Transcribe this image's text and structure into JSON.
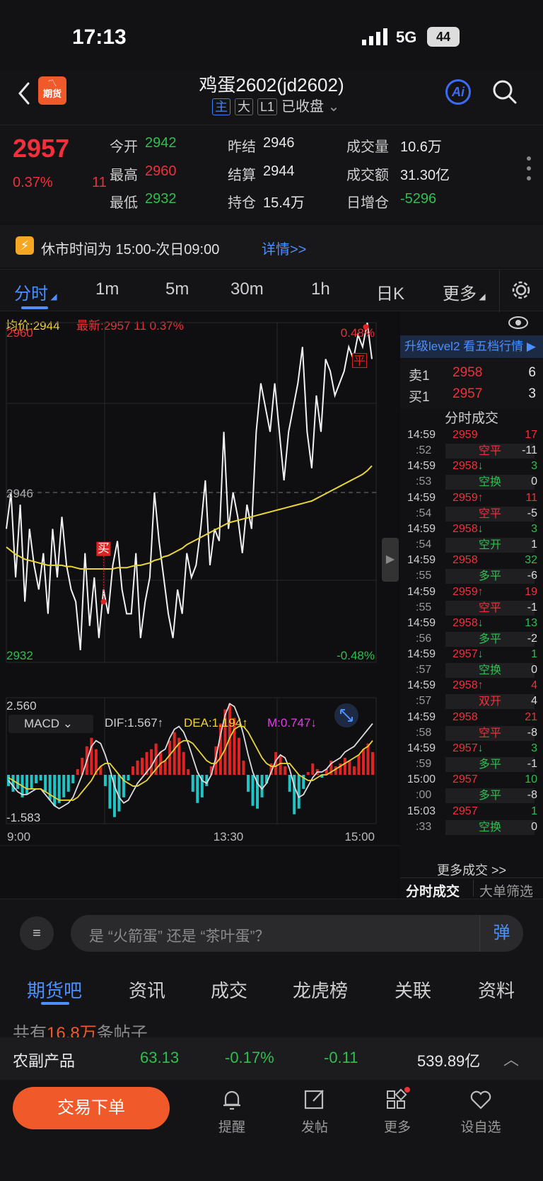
{
  "status": {
    "time": "17:13",
    "network": "5G",
    "battery": "44"
  },
  "header": {
    "logo_text": "期货",
    "title": "鸡蛋2602(jd2602)",
    "badges": [
      "主",
      "大",
      "L1"
    ],
    "status": "已收盘",
    "ai": "Ai"
  },
  "quote": {
    "price": "2957",
    "change_pct": "0.37%",
    "change": "11",
    "fields": [
      {
        "label": "今开",
        "value": "2942",
        "color": "green"
      },
      {
        "label": "昨结",
        "value": "2946",
        "color": "white"
      },
      {
        "label": "成交量",
        "value": "10.6万",
        "color": "white"
      },
      {
        "label": "最高",
        "value": "2960",
        "color": "red"
      },
      {
        "label": "结算",
        "value": "2944",
        "color": "white"
      },
      {
        "label": "成交额",
        "value": "31.30亿",
        "color": "white"
      },
      {
        "label": "最低",
        "value": "2932",
        "color": "green"
      },
      {
        "label": "持仓",
        "value": "15.4万",
        "color": "white"
      },
      {
        "label": "日增仓",
        "value": "-5296",
        "color": "green"
      }
    ]
  },
  "notice": {
    "text": "休市时间为 15:00-次日09:00",
    "link": "详情>>"
  },
  "tabs": [
    "分时",
    "1m",
    "5m",
    "30m",
    "1h",
    "日K",
    "更多"
  ],
  "chart_info": {
    "avg_label": "均价:2944",
    "latest_label": "最新:2957 11 0.37%"
  },
  "chart_data": {
    "type": "line",
    "ylim": [
      2932,
      2960
    ],
    "x_ticks": [
      "9:00",
      "13:30",
      "15:00"
    ],
    "y_labels": {
      "top": "2960",
      "mid": "2946",
      "bottom": "2932",
      "top_pct": "0.48%",
      "bottom_pct": "-0.48%"
    },
    "series": [
      {
        "name": "价格",
        "values": [
          2943,
          2946,
          2939,
          2945,
          2937,
          2943,
          2940,
          2938,
          2941,
          2936,
          2943,
          2939,
          2944,
          2940,
          2938,
          2937,
          2933,
          2941,
          2935,
          2939,
          2934,
          2938,
          2936,
          2940,
          2942,
          2938,
          2936,
          2936,
          2941,
          2934,
          2937,
          2939,
          2946,
          2942,
          2939,
          2936,
          2934,
          2938,
          2936,
          2941,
          2939,
          2940,
          2943,
          2947,
          2940,
          2943,
          2942,
          2951,
          2943,
          2946,
          2944,
          2941,
          2945,
          2943,
          2951,
          2955,
          2953,
          2951,
          2955,
          2951,
          2947,
          2951,
          2953,
          2955,
          2958,
          2951,
          2948,
          2954,
          2951,
          2957,
          2956,
          2954,
          2955,
          2956,
          2958,
          2957,
          2959,
          2958,
          2960,
          2957
        ]
      },
      {
        "name": "均价",
        "values": [
          2941.5,
          2941.2,
          2940.9,
          2940.7,
          2940.5,
          2940.4,
          2940.3,
          2940.2,
          2940.1,
          2940.0,
          2940.0,
          2940.0,
          2940.0,
          2939.9,
          2939.9,
          2939.8,
          2939.7,
          2939.7,
          2939.7,
          2939.7,
          2939.7,
          2939.7,
          2939.7,
          2939.7,
          2939.8,
          2939.8,
          2939.8,
          2939.9,
          2940.0,
          2940.0,
          2940.1,
          2940.2,
          2940.4,
          2940.5,
          2940.7,
          2940.8,
          2941.0,
          2941.2,
          2941.4,
          2941.7,
          2941.9,
          2942.1,
          2942.3,
          2942.5,
          2942.7,
          2942.9,
          2943.1,
          2943.3,
          2943.5,
          2943.6,
          2943.7,
          2943.8,
          2943.9,
          2944.0,
          2944.1,
          2944.2,
          2944.3,
          2944.4,
          2944.5,
          2944.6,
          2944.7,
          2944.8,
          2944.9,
          2945.0,
          2945.1,
          2945.2,
          2945.3,
          2945.5,
          2945.7,
          2945.9,
          2946.1,
          2946.3,
          2946.5,
          2946.7,
          2946.9,
          2947.1,
          2947.3,
          2947.5,
          2947.8,
          2948.2
        ]
      }
    ],
    "markers": [
      {
        "text": "买"
      },
      {
        "text": "平"
      }
    ],
    "macd": {
      "label": "MACD",
      "dif": "DIF:1.567↑",
      "dea": "DEA:1.194↑",
      "m": "M:0.747↓",
      "ymax": "2.560",
      "ymin": "-1.583",
      "hist": [
        -0.4,
        -0.6,
        -0.5,
        -0.8,
        -0.7,
        -0.5,
        -0.3,
        -0.2,
        -0.6,
        -0.9,
        -1.1,
        -1.0,
        -0.8,
        -0.6,
        -0.3,
        0.2,
        0.6,
        1.0,
        1.3,
        0.9,
        0.3,
        -0.4,
        -1.2,
        -1.5,
        -1.3,
        -0.8,
        -0.2,
        0.3,
        0.5,
        0.6,
        0.8,
        0.9,
        1.1,
        0.8,
        0.5,
        1.2,
        1.5,
        1.3,
        0.8,
        0.2,
        -0.6,
        -1.0,
        -0.8,
        -0.4,
        0.3,
        1.0,
        1.8,
        2.3,
        2.5,
        2.0,
        1.3,
        0.5,
        -0.6,
        -1.1,
        -1.2,
        -0.8,
        -0.3,
        0.4,
        0.8,
        0.7,
        0.3,
        -0.6,
        -1.4,
        -1.2,
        -0.5,
        0.1,
        0.4,
        0.2,
        -0.1,
        0.2,
        0.5,
        0.3,
        0.4,
        0.6,
        0.5,
        0.3,
        0.7,
        0.9,
        1.1,
        0.8
      ],
      "dif_values": [
        -0.2,
        -0.4,
        -0.6,
        -0.7,
        -0.7,
        -0.6,
        -0.5,
        -0.5,
        -0.7,
        -0.9,
        -1.1,
        -1.2,
        -1.1,
        -1.0,
        -0.8,
        -0.4,
        0.0,
        0.5,
        1.0,
        1.2,
        1.1,
        0.7,
        0.2,
        -0.4,
        -0.8,
        -1.0,
        -0.9,
        -0.6,
        -0.3,
        -0.1,
        0.1,
        0.3,
        0.6,
        0.8,
        0.9,
        1.3,
        1.6,
        1.7,
        1.5,
        1.1,
        0.6,
        0.1,
        -0.2,
        -0.3,
        0.0,
        0.6,
        1.4,
        2.1,
        2.5,
        2.4,
        2.0,
        1.4,
        0.7,
        0.1,
        -0.3,
        -0.5,
        -0.3,
        0.1,
        0.5,
        0.7,
        0.6,
        0.2,
        -0.4,
        -0.8,
        -0.7,
        -0.4,
        -0.1,
        0.1,
        0.1,
        0.2,
        0.4,
        0.5,
        0.6,
        0.8,
        0.9,
        1.0,
        1.2,
        1.4,
        1.6,
        1.8
      ],
      "dea_values": [
        -0.1,
        -0.2,
        -0.3,
        -0.4,
        -0.5,
        -0.5,
        -0.5,
        -0.5,
        -0.6,
        -0.7,
        -0.8,
        -0.9,
        -0.9,
        -0.9,
        -0.9,
        -0.8,
        -0.6,
        -0.4,
        -0.2,
        0.1,
        0.3,
        0.4,
        0.4,
        0.2,
        0.0,
        -0.2,
        -0.3,
        -0.4,
        -0.4,
        -0.3,
        -0.2,
        0.0,
        0.2,
        0.4,
        0.5,
        0.7,
        0.9,
        1.1,
        1.2,
        1.2,
        1.1,
        0.9,
        0.7,
        0.5,
        0.4,
        0.4,
        0.6,
        0.9,
        1.3,
        1.6,
        1.7,
        1.7,
        1.5,
        1.2,
        0.9,
        0.6,
        0.4,
        0.3,
        0.3,
        0.4,
        0.4,
        0.4,
        0.2,
        0.0,
        -0.1,
        -0.2,
        -0.2,
        -0.1,
        0.0,
        0.0,
        0.1,
        0.2,
        0.3,
        0.4,
        0.5,
        0.6,
        0.7,
        0.9,
        1.0,
        1.2
      ]
    }
  },
  "orderbook": {
    "banner": "升级level2 看五档行情 ▶",
    "sell_label": "卖1",
    "sell_price": "2958",
    "sell_vol": "6",
    "buy_label": "买1",
    "buy_price": "2957",
    "buy_vol": "3"
  },
  "trades_title": "分时成交",
  "trades": [
    {
      "t1": "14:59",
      "t2": ":52",
      "price": "2959",
      "dir": "",
      "pc": "red",
      "vol": "17",
      "vc": "red",
      "kind": "空平",
      "kc": "red",
      "kv": "-11",
      "kvc": "gray"
    },
    {
      "t1": "14:59",
      "t2": ":53",
      "price": "2958",
      "dir": "↓",
      "pc": "red",
      "vol": "3",
      "vc": "green",
      "kind": "空换",
      "kc": "green",
      "kv": "0",
      "kvc": "gray"
    },
    {
      "t1": "14:59",
      "t2": ":54",
      "price": "2959",
      "dir": "↑",
      "pc": "red",
      "vol": "11",
      "vc": "red",
      "kind": "空平",
      "kc": "red",
      "kv": "-5",
      "kvc": "gray"
    },
    {
      "t1": "14:59",
      "t2": ":54",
      "price": "2958",
      "dir": "↓",
      "pc": "red",
      "vol": "3",
      "vc": "green",
      "kind": "空开",
      "kc": "green",
      "kv": "1",
      "kvc": "gray"
    },
    {
      "t1": "14:59",
      "t2": ":55",
      "price": "2958",
      "dir": "",
      "pc": "red",
      "vol": "32",
      "vc": "green",
      "kind": "多平",
      "kc": "green",
      "kv": "-6",
      "kvc": "gray"
    },
    {
      "t1": "14:59",
      "t2": ":55",
      "price": "2959",
      "dir": "↑",
      "pc": "red",
      "vol": "19",
      "vc": "red",
      "kind": "空平",
      "kc": "red",
      "kv": "-1",
      "kvc": "gray"
    },
    {
      "t1": "14:59",
      "t2": ":56",
      "price": "2958",
      "dir": "↓",
      "pc": "red",
      "vol": "13",
      "vc": "green",
      "kind": "多平",
      "kc": "green",
      "kv": "-2",
      "kvc": "gray"
    },
    {
      "t1": "14:59",
      "t2": ":57",
      "price": "2957",
      "dir": "↓",
      "pc": "red",
      "vol": "1",
      "vc": "green",
      "kind": "空换",
      "kc": "green",
      "kv": "0",
      "kvc": "gray"
    },
    {
      "t1": "14:59",
      "t2": ":57",
      "price": "2958",
      "dir": "↑",
      "pc": "red",
      "vol": "4",
      "vc": "red",
      "kind": "双开",
      "kc": "red",
      "kv": "4",
      "kvc": "gray"
    },
    {
      "t1": "14:59",
      "t2": ":58",
      "price": "2958",
      "dir": "",
      "pc": "red",
      "vol": "21",
      "vc": "red",
      "kind": "空平",
      "kc": "red",
      "kv": "-8",
      "kvc": "gray"
    },
    {
      "t1": "14:59",
      "t2": ":59",
      "price": "2957",
      "dir": "↓",
      "pc": "red",
      "vol": "3",
      "vc": "green",
      "kind": "多平",
      "kc": "green",
      "kv": "-1",
      "kvc": "gray"
    },
    {
      "t1": "15:00",
      "t2": ":00",
      "price": "2957",
      "dir": "",
      "pc": "red",
      "vol": "10",
      "vc": "green",
      "kind": "多平",
      "kc": "green",
      "kv": "-8",
      "kvc": "gray"
    },
    {
      "t1": "15:03",
      "t2": ":33",
      "price": "2957",
      "dir": "",
      "pc": "red",
      "vol": "1",
      "vc": "green",
      "kind": "空换",
      "kc": "green",
      "kv": "0",
      "kvc": "gray"
    }
  ],
  "trades_more": "更多成交 >>",
  "trade_tabs": [
    "分时成交",
    "大单筛选"
  ],
  "comment": {
    "placeholder": "是 “火箭蛋” 还是 “茶叶蛋”？",
    "danmu": "弹"
  },
  "bottom_tabs": [
    "期货吧",
    "资讯",
    "成交",
    "龙虎榜",
    "关联",
    "资料"
  ],
  "posts": {
    "prefix": "共有",
    "count": "16.8万",
    "suffix": "条帖子"
  },
  "sector": {
    "name": "农副产品",
    "v1": "63.13",
    "v2": "-0.17%",
    "v3": "-0.11",
    "v4": "539.89亿"
  },
  "dock": {
    "trade_button": "交易下单",
    "items": [
      "提醒",
      "发帖",
      "更多",
      "设自选"
    ]
  }
}
